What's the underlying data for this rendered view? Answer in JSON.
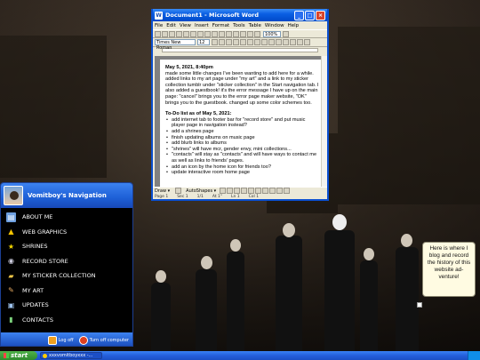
{
  "word": {
    "title": "Document1 - Microsoft Word",
    "app_icon": "W",
    "menu": [
      "File",
      "Edit",
      "View",
      "Insert",
      "Format",
      "Tools",
      "Table",
      "Window",
      "Help"
    ],
    "font_name": "Times New Roman",
    "font_size": "12",
    "zoom": "100%",
    "doc": {
      "entry_date": "May 5, 2021, 8:40pm",
      "entry_text": "made some little changes I've been wanting to add here for a while. added links to my art page under \"my art\" and a link to my sticker collection tumblr under \"sticker collection\" in the Start navigation tab. I also added a guestbook! it's the error message I have up on the main page: \"cancel\" brings you to the error page maker website, \"OK\" brings you to the guestbook. changed up some color schemes too.",
      "todo_title": "To-Do list as of May 5, 2021:",
      "todo": [
        "add internet tab to footer bar for \"record store\" and put music player page in navigation instead?",
        "add a shrines page",
        "finish updating albums on music page",
        "add blurb links to albums",
        "\"shrines\" will have mcr, gender envy, mini collections...",
        "\"contacts\" will stay as \"contacts\" and will have ways to contact me as well as links to friends' pages.",
        "add an icon by the home icon for friends too?",
        "update interactive room home page"
      ]
    },
    "drawbar": {
      "draw": "Draw ▾",
      "autoshapes": "AutoShapes ▾"
    },
    "status": [
      "Page 1",
      "Sec 1",
      "1/1",
      "At 1\"",
      "Ln 1",
      "Col 1"
    ]
  },
  "startmenu": {
    "user": "Vomitboy's Navigation",
    "items": [
      {
        "label": "ABOUT ME",
        "icon": "id-card-icon"
      },
      {
        "label": "WEB GRAPHICS",
        "icon": "warning-icon"
      },
      {
        "label": "SHRINES",
        "icon": "star-icon"
      },
      {
        "label": "RECORD STORE",
        "icon": "cd-icon"
      },
      {
        "label": "MY STICKER COLLECTION",
        "icon": "folder-icon"
      },
      {
        "label": "MY ART",
        "icon": "paint-icon"
      },
      {
        "label": "UPDATES",
        "icon": "computer-icon"
      },
      {
        "label": "CONTACTS",
        "icon": "bottle-icon"
      }
    ],
    "logoff": "Log off",
    "turnoff": "Turn off computer"
  },
  "note": {
    "text": "Here is where I blog and record the history of this website ad-venture!"
  },
  "taskbar": {
    "start": "start",
    "task_label": "xxxvomitboyxxx -..."
  },
  "colors": {
    "xp_blue": "#245edc",
    "start_green": "#3c9a38",
    "note_bg": "#fffbe2"
  }
}
